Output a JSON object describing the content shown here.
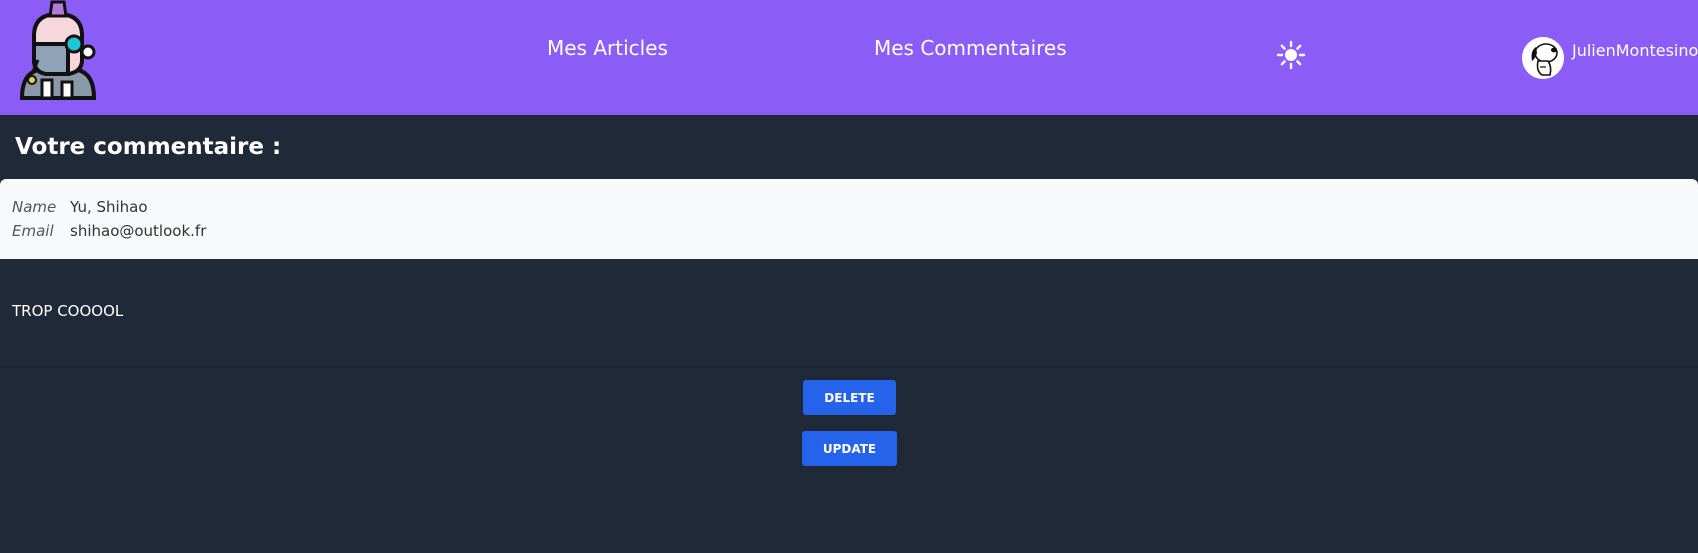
{
  "header": {
    "logo_icon": "cyborg-avatar-icon",
    "nav": [
      {
        "label": "Mes Articles"
      },
      {
        "label": "Mes Commentaires"
      }
    ],
    "theme_toggle_icon": "sun-icon",
    "user": {
      "avatar_icon": "snoopy-avatar-icon",
      "name": "JulienMontesinos"
    }
  },
  "main": {
    "heading": "Votre commentaire :",
    "comment": {
      "name_label": "Name",
      "name_value": "Yu, Shihao",
      "email_label": "Email",
      "email_value": "shihao@outlook.fr",
      "text": "TROP COOOOL"
    },
    "actions": {
      "delete_label": "DELETE",
      "update_label": "UPDATE"
    }
  },
  "colors": {
    "navbar": "#8b5cf6",
    "page_background": "#1f2937",
    "card_background": "#f8f9fa",
    "button": "#2563eb"
  }
}
